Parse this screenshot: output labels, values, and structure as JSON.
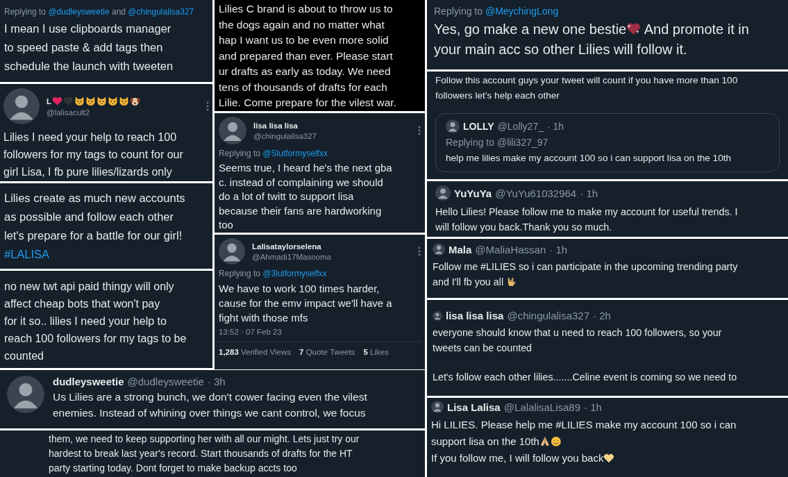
{
  "left_column": [
    {
      "kind": "plain",
      "replying": {
        "label": "Replying to",
        "mentions": [
          "@dudleysweetie",
          "@chingulalisa327"
        ],
        "joiner": "and"
      },
      "paragraphs": [
        [
          "I mean I use clipboards manager",
          "to speed paste & add tags then",
          "schedule the launch with tweeten"
        ]
      ]
    },
    {
      "kind": "stacked",
      "name": [
        "L",
        {
          "kind": "emoji"
        },
        {
          "kind": "emoji"
        },
        {
          "kind": "emoji"
        },
        {
          "kind": "emoji"
        },
        {
          "kind": "emoji"
        },
        {
          "kind": "emoji"
        },
        {
          "kind": "emoji"
        },
        {
          "kind": "emoji"
        }
      ],
      "handle": "@lalisacult2",
      "paragraphs": [
        [
          "Lilies I need your help to reach 100",
          "followers for my tags to count for our",
          "girl Lisa, I fb pure lilies/lizards only"
        ]
      ]
    },
    {
      "kind": "plain",
      "paragraphs": [
        [
          "Lilies create as much new accounts",
          "as possible and follow each other",
          "let's prepare for a battle for our girl!",
          [
            {
              "kind": "link",
              "text": "#LALISA"
            }
          ]
        ]
      ]
    },
    {
      "kind": "plain",
      "paragraphs": [
        [
          "no new twt api paid thingy will only",
          "affect cheap bots that won't pay",
          "for it so.. lilies I need your help to",
          "reach 100 followers for my tags to be",
          "counted"
        ]
      ]
    }
  ],
  "middle_column": [
    {
      "kind": "plain",
      "paragraphs": [
        [
          "Lilies C brand is about to throw us to",
          "the dogs again and no matter what",
          "hap I want us to be even more solid",
          "and prepared than ever. Please start",
          "ur drafts as early as today. We need",
          "tens of thousands of drafts for each",
          "Lilie. Come prepare for the vilest war."
        ]
      ]
    },
    {
      "kind": "stacked",
      "name": "lisa lisa lisa",
      "handle": "@chingulalisa327",
      "replying": {
        "label": "Replying to",
        "mentions": [
          "@Slutformyselfxx"
        ]
      },
      "paragraphs": [
        [
          "Seems true, I heard he's the next gba",
          "c. instead of complaining we should",
          "do a lot of twitt to support lisa",
          "because their fans are hardworking",
          "too"
        ]
      ]
    },
    {
      "kind": "stacked",
      "name": "Lalisataylorselena",
      "handle": "@Ahmadi17Masooma",
      "replying": {
        "label": "Replying to",
        "mentions": [
          "@3lutformyselfxx"
        ]
      },
      "paragraphs": [
        [
          "We have to work 100 times harder,",
          "cause for the emv impact we'll have a",
          "fight with those mfs"
        ]
      ],
      "timestamp": "13:52 · 07 Feb 23",
      "stats": [
        {
          "count": "1,283",
          "label": "Verified Views"
        },
        {
          "count": "7",
          "label": "Quote Tweets"
        },
        {
          "count": "5",
          "label": "Likes"
        }
      ]
    }
  ],
  "bottom_row": [
    {
      "kind": "inline",
      "name": "dudleysweetie",
      "handle": "@dudleysweetie",
      "time": "· 3h",
      "paragraphs": [
        [
          "Us Lilies are a strong bunch, we don't cower facing even the vilest",
          "enemies. Instead of whining over things we cant control, we focus"
        ]
      ]
    },
    {
      "kind": "plain",
      "paragraphs": [
        [
          "them, we need to keep supporting her with all our might. Lets just try our",
          "hardest to break last year's record. Start thousands of drafts for the HT",
          "party starting today. Dont forget to make backup accts too"
        ]
      ]
    }
  ],
  "right_column": [
    {
      "kind": "plain",
      "replying": {
        "label": "Replying to",
        "mentions": [
          "@MeychingLong"
        ]
      },
      "paragraphs": [
        [
          [
            "Yes, go make a new one bestie",
            {
              "kind": "emoji"
            },
            " And promote it in"
          ],
          "your main acc so other Lilies will follow it."
        ]
      ]
    },
    {
      "kind": "plain",
      "paragraphs": [
        [
          "Follow this account guys your tweet will count if you have more than 100",
          "followers let’s help each other"
        ]
      ],
      "quote": {
        "kind": "inline",
        "name": "LOLLY",
        "handle": "@Lolly27_",
        "time": "· 1h",
        "replying": {
          "label": "Replying to",
          "mentions": [
            "@lili327_97"
          ]
        },
        "paragraphs": [
          [
            "help me lilies make my account 100 so i can support lisa on the 10th"
          ]
        ]
      }
    },
    {
      "kind": "inline",
      "name": "YuYuYa",
      "handle": "@YuYu61032964",
      "time": "· 1h",
      "paragraphs": [
        [
          "Hello Lilies! Please follow me to make my account for useful trends. I",
          "will follow you back.Thank you so much."
        ]
      ]
    },
    {
      "kind": "inline",
      "name": "Mala",
      "handle": "@MaliaHassan",
      "time": "· 1h",
      "paragraphs": [
        [
          "Follow me #LILIES so i can participate in the upcoming trending party",
          [
            "and I'll fb you all ",
            {
              "kind": "emoji"
            }
          ]
        ]
      ]
    },
    {
      "kind": "inline",
      "name": "lisa lisa lisa",
      "handle": "@chingulalisa327",
      "time": "· 2h",
      "paragraphs": [
        [
          "everyone should know that u need to reach 100 followers, so your",
          "tweets can be counted"
        ],
        [
          "Let's follow each other lilies.......Celine event is coming so we need to"
        ]
      ]
    },
    {
      "kind": "inline",
      "name": "Lisa Lalisa",
      "handle": "@LalalisaLisa89",
      "time": "· 1h",
      "paragraphs": [
        [
          "Hi LILIES. Please help me #LILIES make my account 100 so i can",
          [
            "support lisa on the 10th",
            {
              "kind": "emoji"
            },
            {
              "kind": "emoji"
            }
          ],
          [
            "If you follow me, I will follow you back",
            {
              "kind": "emoji"
            }
          ]
        ]
      ]
    }
  ]
}
